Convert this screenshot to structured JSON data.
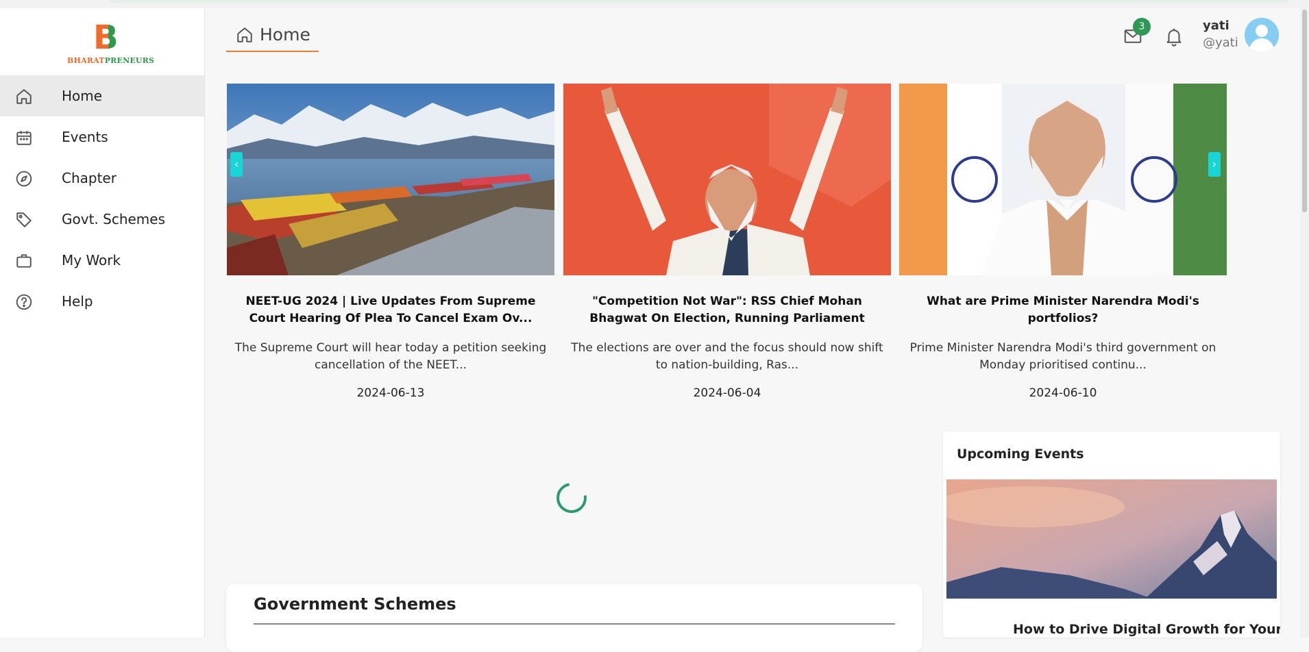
{
  "brand": {
    "logo_letter": "B",
    "tagline_part1": "BHARAT",
    "tagline_part2": "PRENEURS"
  },
  "sidebar": {
    "items": [
      {
        "label": "Home",
        "icon": "home-icon",
        "active": true
      },
      {
        "label": "Events",
        "icon": "calendar-icon"
      },
      {
        "label": "Chapter",
        "icon": "compass-icon"
      },
      {
        "label": "Govt. Schemes",
        "icon": "tag-icon"
      },
      {
        "label": "My Work",
        "icon": "briefcase-icon"
      },
      {
        "label": "Help",
        "icon": "help-circle-icon"
      }
    ]
  },
  "header": {
    "tab_label": "Home",
    "mail_badge": "3",
    "user": {
      "name": "yati",
      "handle": "@yati"
    }
  },
  "news": [
    {
      "title": "NEET-UG 2024 | Live Updates From Supreme Court Hearing Of Plea To Cancel Exam Ov...",
      "summary": "The Supreme Court will hear today a petition seeking cancellation of the NEET...",
      "date": "2024-06-13"
    },
    {
      "title": "\"Competition Not War\": RSS Chief Mohan Bhagwat On Election, Running Parliament",
      "summary": "The elections are over and the focus should now shift to nation-building, Ras...",
      "date": "2024-06-04"
    },
    {
      "title": "What are Prime Minister Narendra Modi's portfolios?",
      "summary": "Prime Minister Narendra Modi's third government on Monday prioritised continu...",
      "date": "2024-06-10"
    }
  ],
  "carousel": {
    "prev": "‹",
    "next": "›"
  },
  "upcoming_events": {
    "heading": "Upcoming Events",
    "first_title": "How to Drive Digital Growth for Your"
  },
  "schemes": {
    "heading": "Government Schemes"
  },
  "colors": {
    "accent": "#f07b34",
    "badge": "#2c9a55",
    "carousel_btn": "#19d6d6",
    "spinner": "#2b9a6f"
  }
}
